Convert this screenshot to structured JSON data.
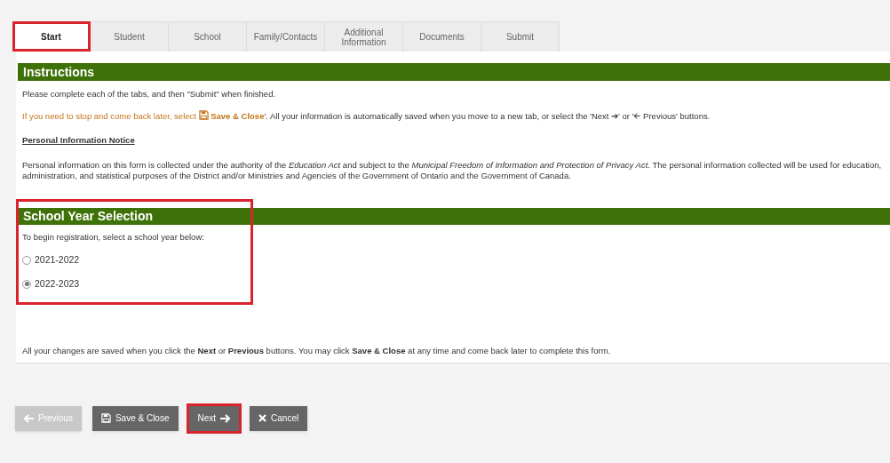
{
  "tabs": [
    {
      "label": "Start",
      "selected": true,
      "highlighted": true
    },
    {
      "label": "Student",
      "selected": false,
      "highlighted": false
    },
    {
      "label": "School",
      "selected": false,
      "highlighted": false
    },
    {
      "label": "Family/Contacts",
      "selected": false,
      "highlighted": false
    },
    {
      "label": "Additional Information",
      "selected": false,
      "highlighted": false
    },
    {
      "label": "Documents",
      "selected": false,
      "highlighted": false
    },
    {
      "label": "Submit",
      "selected": false,
      "highlighted": false
    }
  ],
  "instructions": {
    "title": "Instructions",
    "intro": "Please complete each of the tabs, and then \"Submit\" when finished.",
    "save_note_lead": "If you need to stop and come back later, select",
    "save_note_action": "Save & Close",
    "save_note_rest": "'. All your information is automatically saved when you move to a new tab, or select the 'Next ➔' or '🡨 Previous' buttons.",
    "notice_title": "Personal Information Notice",
    "notice_text": "Personal information on this form is collected under the authority of the *Education Act* and subject to the *Municipal Freedom of Information and Protection of Privacy Act*. The personal information collected will be used for education, administration, and statistical purposes of the District and/or Ministries and Agencies of the Government of Ontario and the Government of Canada."
  },
  "school_year": {
    "title": "School Year Selection",
    "highlighted": true,
    "prompt": "To begin registration, select a school year below:",
    "options": [
      {
        "label": "2021-2022",
        "selected": false
      },
      {
        "label": "2022-2023",
        "selected": true
      }
    ]
  },
  "footer_note": "All your changes are saved when you click the **Next** or **Previous** buttons. You may click **Save & Close** at any time and come back later to complete this form.",
  "buttons": [
    {
      "kind": "previous",
      "label": "Previous",
      "disabled": true,
      "highlighted": false
    },
    {
      "kind": "save",
      "label": "Save & Close",
      "disabled": false,
      "highlighted": false
    },
    {
      "kind": "next",
      "label": "Next",
      "disabled": false,
      "highlighted": true
    },
    {
      "kind": "cancel",
      "label": "Cancel",
      "disabled": false,
      "highlighted": false
    }
  ]
}
